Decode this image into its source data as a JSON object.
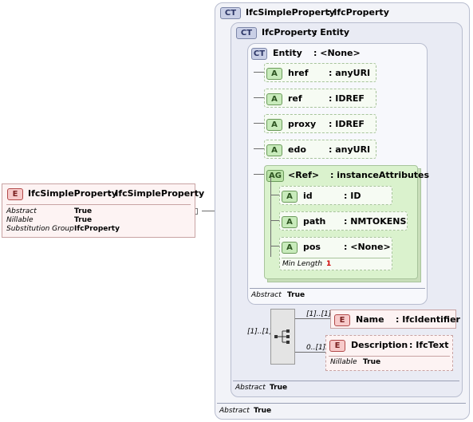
{
  "root_element": {
    "badge": "E",
    "name": "IfcSimpleProperty",
    "type": ": IfcSimpleProperty",
    "props": [
      {
        "label": "Abstract",
        "value": "True"
      },
      {
        "label": "Nillable",
        "value": "True"
      },
      {
        "label": "Substitution Group",
        "value": "IfcProperty"
      }
    ]
  },
  "outer_type": {
    "badge": "CT",
    "name": "IfcSimpleProperty",
    "type": ": IfcProperty",
    "abstract_label": "Abstract",
    "abstract_value": "True"
  },
  "mid_type": {
    "badge": "CT",
    "name": "IfcProperty",
    "type": ": Entity",
    "abstract_label": "Abstract",
    "abstract_value": "True"
  },
  "inner_type": {
    "badge": "CT",
    "name": "Entity",
    "type": ": <None>",
    "abstract_label": "Abstract",
    "abstract_value": "True"
  },
  "attributes": [
    {
      "badge": "A",
      "name": "href",
      "type": ": anyURI"
    },
    {
      "badge": "A",
      "name": "ref",
      "type": ": IDREF"
    },
    {
      "badge": "A",
      "name": "proxy",
      "type": ": IDREF"
    },
    {
      "badge": "A",
      "name": "edo",
      "type": ": anyURI"
    }
  ],
  "attribute_group": {
    "badge": "AG",
    "name": "<Ref>",
    "type": ": instanceAttributes",
    "attributes": [
      {
        "badge": "A",
        "name": "id",
        "type": ": ID"
      },
      {
        "badge": "A",
        "name": "path",
        "type": ": NMTOKENS"
      },
      {
        "badge": "A",
        "name": "pos",
        "type": ": <None>",
        "facet_label": "Min Length",
        "facet_value": "1"
      }
    ]
  },
  "sequence": {
    "occurrence": "[1]..[1]"
  },
  "children": [
    {
      "badge": "E",
      "name": "Name",
      "type": ": IfcIdentifier",
      "occurrence": "[1]..[1]"
    },
    {
      "badge": "E",
      "name": "Description",
      "type": ": IfcText",
      "occurrence": "0..[1]",
      "prop_label": "Nillable",
      "prop_value": "True"
    }
  ],
  "colors": {
    "element_fill": "#fdf3f3",
    "element_badge": "#f7caca",
    "attribute_fill": "#daf2cd",
    "type_fill": "#e9ebf4"
  }
}
